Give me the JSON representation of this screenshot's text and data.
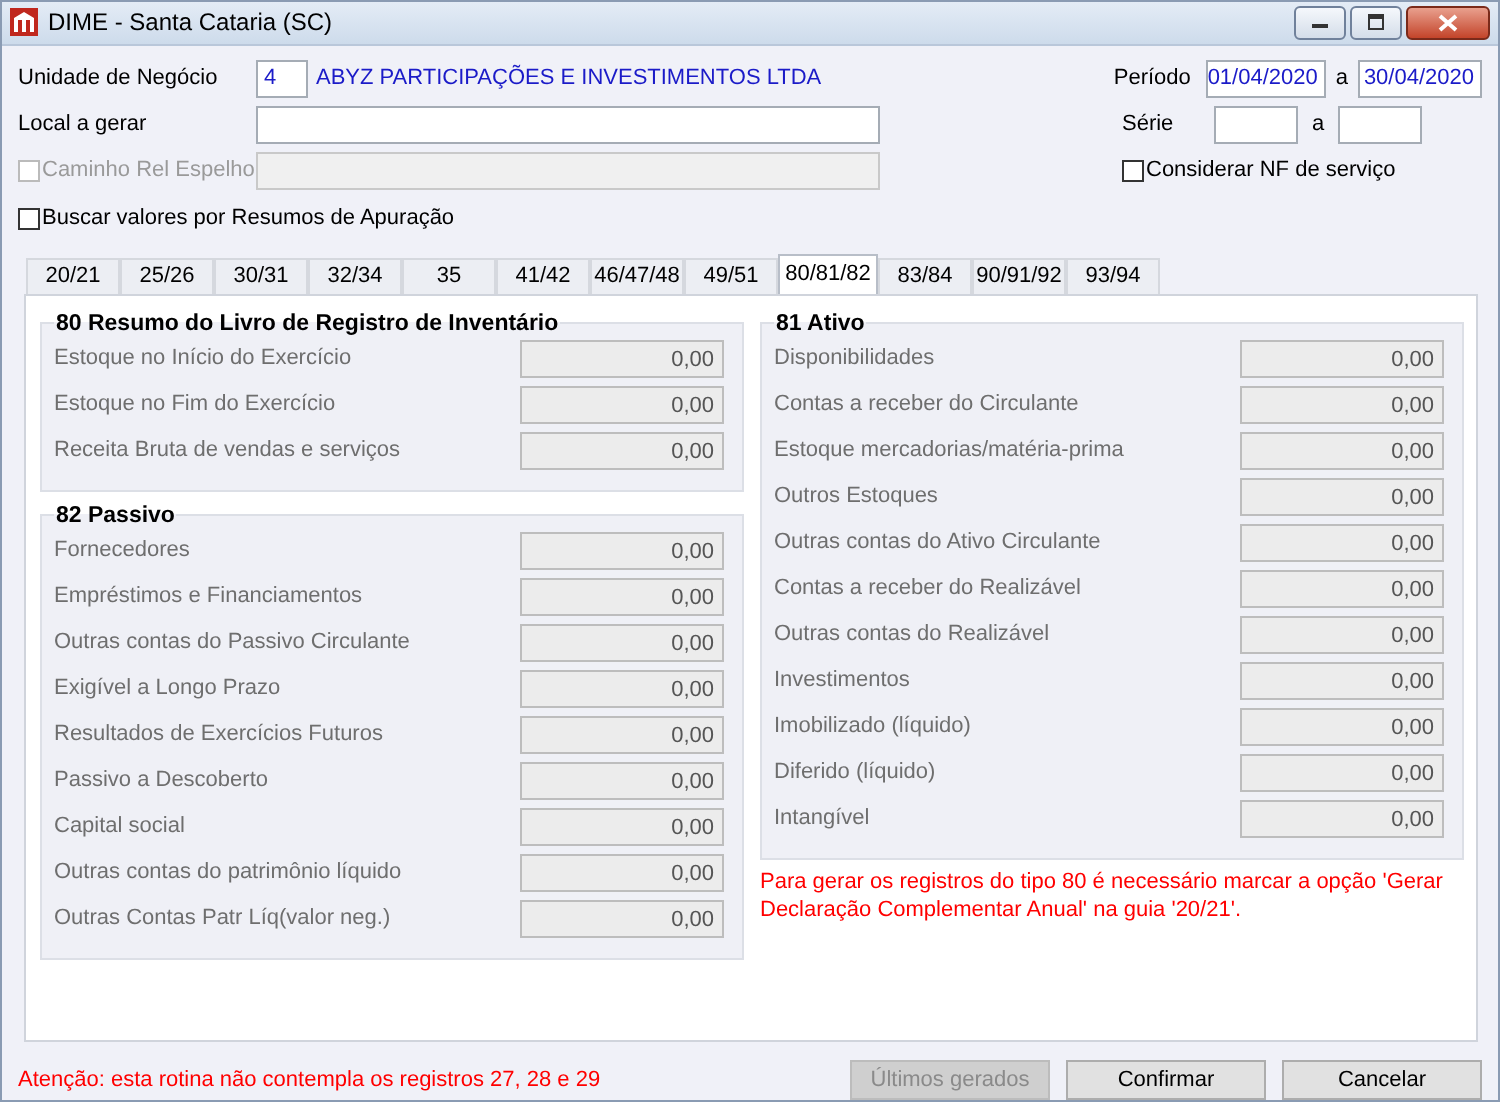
{
  "window": {
    "title": "DIME - Santa Cataria (SC)"
  },
  "form": {
    "unit": {
      "label": "Unidade de Negócio",
      "code": "4",
      "name": "ABYZ PARTICIPAÇÕES E INVESTIMENTOS LTDA"
    },
    "period": {
      "label": "Período",
      "from": "01/04/2020",
      "sep": "a",
      "to": "30/04/2020"
    },
    "local": {
      "label": "Local a gerar"
    },
    "serie": {
      "label": "Série",
      "sep": "a"
    },
    "caminho": {
      "label": "Caminho Rel Espelho",
      "checked": false,
      "disabled": true
    },
    "considerar": {
      "label": "Considerar NF de serviço",
      "checked": false
    },
    "buscar": {
      "label": "Buscar valores por Resumos de Apuração",
      "checked": false
    }
  },
  "tabs": [
    {
      "label": "20/21",
      "selected": false
    },
    {
      "label": "25/26",
      "selected": false
    },
    {
      "label": "30/31",
      "selected": false
    },
    {
      "label": "32/34",
      "selected": false
    },
    {
      "label": "35",
      "selected": false
    },
    {
      "label": "41/42",
      "selected": false
    },
    {
      "label": "46/47/48",
      "selected": false
    },
    {
      "label": "49/51",
      "selected": false
    },
    {
      "label": "80/81/82",
      "selected": true
    },
    {
      "label": "83/84",
      "selected": false
    },
    {
      "label": "90/91/92",
      "selected": false
    },
    {
      "label": "93/94",
      "selected": false
    }
  ],
  "left_groups": [
    {
      "title": "80 Resumo do Livro de Registro de Inventário",
      "rows": [
        {
          "label": "Estoque no Início do Exercício",
          "value": "0,00"
        },
        {
          "label": "Estoque no Fim do Exercício",
          "value": "0,00"
        },
        {
          "label": "Receita Bruta de vendas e serviços",
          "value": "0,00"
        }
      ]
    },
    {
      "title": "82 Passivo",
      "rows": [
        {
          "label": "Fornecedores",
          "value": "0,00"
        },
        {
          "label": "Empréstimos e Financiamentos",
          "value": "0,00"
        },
        {
          "label": "Outras contas do Passivo Circulante",
          "value": "0,00"
        },
        {
          "label": "Exigível a Longo Prazo",
          "value": "0,00"
        },
        {
          "label": "Resultados de Exercícios Futuros",
          "value": "0,00"
        },
        {
          "label": "Passivo a Descoberto",
          "value": "0,00"
        },
        {
          "label": "Capital social",
          "value": "0,00"
        },
        {
          "label": "Outras contas do patrimônio líquido",
          "value": "0,00"
        },
        {
          "label": "Outras Contas Patr Líq(valor neg.)",
          "value": "0,00"
        }
      ]
    }
  ],
  "right_groups": [
    {
      "title": "81 Ativo",
      "rows": [
        {
          "label": "Disponibilidades",
          "value": "0,00"
        },
        {
          "label": "Contas a receber do Circulante",
          "value": "0,00"
        },
        {
          "label": "Estoque mercadorias/matéria-prima",
          "value": "0,00"
        },
        {
          "label": "Outros Estoques",
          "value": "0,00"
        },
        {
          "label": "Outras contas do Ativo Circulante",
          "value": "0,00"
        },
        {
          "label": "Contas a receber do Realizável",
          "value": "0,00"
        },
        {
          "label": "Outras contas do Realizável",
          "value": "0,00"
        },
        {
          "label": "Investimentos",
          "value": "0,00"
        },
        {
          "label": "Imobilizado (líquido)",
          "value": "0,00"
        },
        {
          "label": "Diferido (líquido)",
          "value": "0,00"
        },
        {
          "label": "Intangível",
          "value": "0,00"
        }
      ]
    }
  ],
  "note": "Para gerar os registros do tipo 80 é necessário marcar a opção 'Gerar Declaração Complementar Anual' na guia '20/21'.",
  "footer": {
    "warning": "Atenção: esta rotina não contempla os registros 27, 28 e 29",
    "buttons": [
      {
        "label": "Últimos gerados",
        "disabled": true
      },
      {
        "label": "Confirmar",
        "disabled": false
      },
      {
        "label": "Cancelar",
        "disabled": false
      }
    ]
  }
}
